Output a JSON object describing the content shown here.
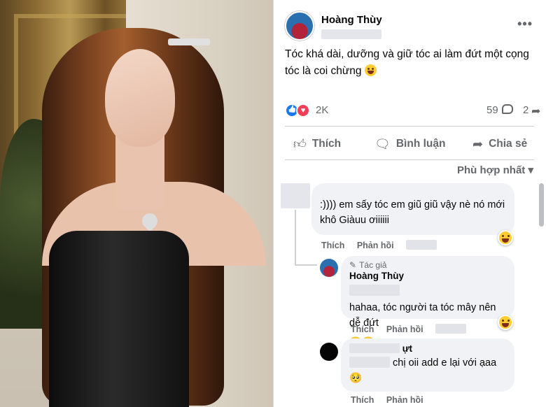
{
  "post": {
    "author": "Hoàng Thùy",
    "text": "Tóc khá dài, dưỡng và giữ tóc ai làm đứt một cọng tóc là coi chừng",
    "more_icon": "more-horizontal-icon",
    "reactions_count": "2K",
    "comments_count": "59",
    "shares_count": "2"
  },
  "actions": {
    "like": "Thích",
    "comment": "Bình luận",
    "share": "Chia sẻ"
  },
  "sort_label": "Phù hợp nhất",
  "comments": [
    {
      "text": ":)))) em sấy tóc em giũ giũ vậy nè nó mới khô Giàuu ơiiiiii",
      "like": "Thích",
      "reply": "Phản hồi"
    },
    {
      "badge": "Tác giả",
      "name": "Hoàng Thùy",
      "text": "hahaa, tóc người ta tóc mây nên dễ đứt",
      "like": "Thích",
      "reply": "Phản hồi"
    },
    {
      "name_fragment": "ựt",
      "text": "chị oii add e lại với ạaa",
      "like": "Thích",
      "reply": "Phản hồi"
    }
  ],
  "colors": {
    "like_blue": "#1877f2",
    "love_red": "#f33e58",
    "secondary_text": "#65676b",
    "bubble_bg": "#f0f2f5"
  }
}
